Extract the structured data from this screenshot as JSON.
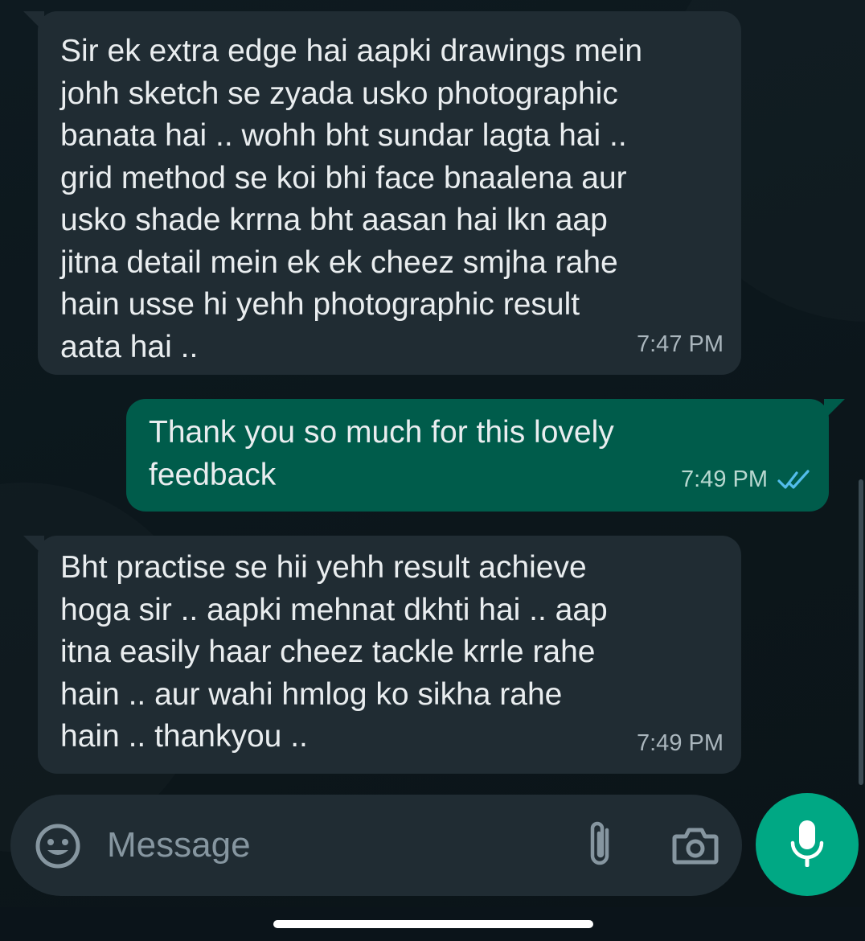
{
  "conversation": {
    "messages": [
      {
        "direction": "incoming",
        "text": "Sir ek extra edge hai aapki drawings mein\njohh sketch se zyada usko photographic\nbanata hai .. wohh bht sundar lagta hai ..\ngrid method se koi bhi face bnaalena aur\nusko shade krrna bht aasan hai lkn aap\njitna detail mein ek ek cheez smjha rahe\nhain usse hi yehh photographic result\naata hai ..",
        "time": "7:47 PM"
      },
      {
        "direction": "outgoing",
        "text": "Thank you so much for this lovely\nfeedback",
        "time": "7:49 PM",
        "status_icon": "double-check-read-icon"
      },
      {
        "direction": "incoming",
        "text": "Bht practise se hii yehh result achieve\nhoga sir .. aapki mehnat dkhti hai .. aap\nitna easily haar cheez tackle krrle rahe\nhain .. aur wahi hmlog ko sikha rahe\nhain .. thankyou ..",
        "time": "7:49 PM"
      }
    ]
  },
  "composer": {
    "placeholder": "Message",
    "emoji_icon": "emoji-icon",
    "attach_icon": "paperclip-icon",
    "camera_icon": "camera-icon",
    "mic_icon": "microphone-icon"
  },
  "colors": {
    "background": "#0b141a",
    "incoming_bubble": "#202c33",
    "outgoing_bubble": "#005c4b",
    "read_ticks": "#53bdeb",
    "mic_button": "#00a884"
  }
}
